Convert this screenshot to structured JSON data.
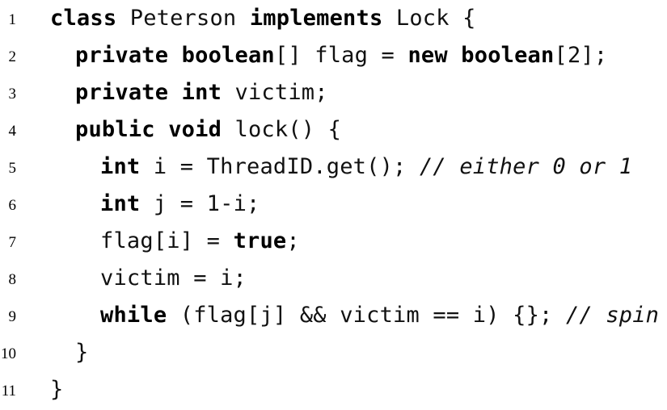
{
  "listing": {
    "lines": [
      {
        "number": "1",
        "indent": 0,
        "tokens": [
          {
            "t": "class",
            "k": "kw"
          },
          {
            "t": " Peterson ",
            "k": "tx"
          },
          {
            "t": "implements",
            "k": "kw"
          },
          {
            "t": " Lock {",
            "k": "tx"
          }
        ]
      },
      {
        "number": "2",
        "indent": 1,
        "tokens": [
          {
            "t": "private",
            "k": "kw"
          },
          {
            "t": " ",
            "k": "tx"
          },
          {
            "t": "boolean",
            "k": "kw"
          },
          {
            "t": "[] flag = ",
            "k": "tx"
          },
          {
            "t": "new",
            "k": "kw"
          },
          {
            "t": " ",
            "k": "tx"
          },
          {
            "t": "boolean",
            "k": "kw"
          },
          {
            "t": "[2];",
            "k": "tx"
          }
        ]
      },
      {
        "number": "3",
        "indent": 1,
        "tokens": [
          {
            "t": "private",
            "k": "kw"
          },
          {
            "t": " ",
            "k": "tx"
          },
          {
            "t": "int",
            "k": "kw"
          },
          {
            "t": " victim;",
            "k": "tx"
          }
        ]
      },
      {
        "number": "4",
        "indent": 1,
        "tokens": [
          {
            "t": "public",
            "k": "kw"
          },
          {
            "t": " ",
            "k": "tx"
          },
          {
            "t": "void",
            "k": "kw"
          },
          {
            "t": " lock() {",
            "k": "tx"
          }
        ]
      },
      {
        "number": "5",
        "indent": 2,
        "tokens": [
          {
            "t": "int",
            "k": "kw"
          },
          {
            "t": " i = ThreadID.get(); ",
            "k": "tx"
          },
          {
            "t": "// either 0 or 1",
            "k": "cm"
          }
        ]
      },
      {
        "number": "6",
        "indent": 2,
        "tokens": [
          {
            "t": "int",
            "k": "kw"
          },
          {
            "t": " j = 1-i;",
            "k": "tx"
          }
        ]
      },
      {
        "number": "7",
        "indent": 2,
        "tokens": [
          {
            "t": "flag[i] = ",
            "k": "tx"
          },
          {
            "t": "true",
            "k": "kw"
          },
          {
            "t": ";",
            "k": "tx"
          }
        ]
      },
      {
        "number": "8",
        "indent": 2,
        "tokens": [
          {
            "t": "victim = i;",
            "k": "tx"
          }
        ]
      },
      {
        "number": "9",
        "indent": 2,
        "tokens": [
          {
            "t": "while",
            "k": "kw"
          },
          {
            "t": " (flag[j] && victim == i) {}; ",
            "k": "tx"
          },
          {
            "t": "// spin",
            "k": "cm"
          }
        ]
      },
      {
        "number": "10",
        "indent": 1,
        "tokens": [
          {
            "t": "}",
            "k": "tx"
          }
        ]
      },
      {
        "number": "11",
        "indent": 0,
        "tokens": [
          {
            "t": "}",
            "k": "tx"
          }
        ]
      }
    ]
  }
}
